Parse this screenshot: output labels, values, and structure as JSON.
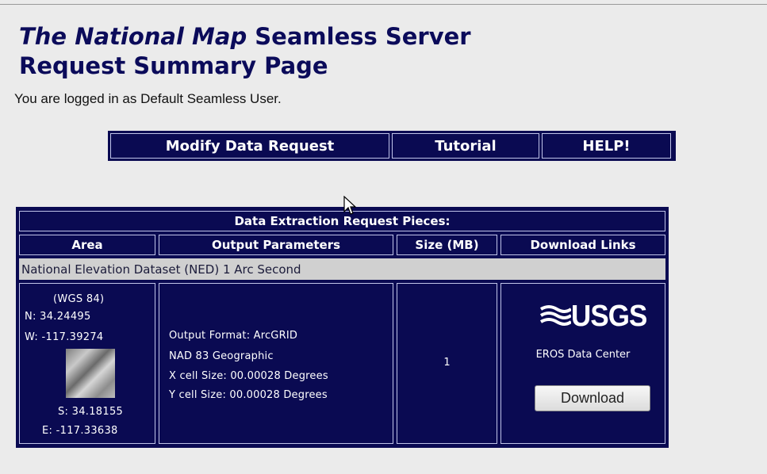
{
  "page": {
    "title_italic": "The National Map",
    "title_rest": " Seamless Server",
    "title_line2": "Request Summary Page",
    "logged_in": "You are logged in as Default Seamless User."
  },
  "nav": {
    "modify": "Modify Data Request",
    "tutorial": "Tutorial",
    "help": "HELP!"
  },
  "table": {
    "heading": "Data Extraction Request Pieces:",
    "columns": [
      "Area",
      "Output Parameters",
      "Size (MB)",
      "Download Links"
    ],
    "dataset": "National Elevation Dataset (NED) 1 Arc Second",
    "area": {
      "datum": "(WGS 84)",
      "north": "N: 34.24495",
      "west": "W: -117.39274",
      "south": "S: 34.18155",
      "east": "E: -117.33638"
    },
    "params": {
      "format": "Output Format: ArcGRID",
      "projection": "NAD 83 Geographic",
      "x_cell": "X cell Size: 00.00028 Degrees",
      "y_cell": "Y cell Size: 00.00028 Degrees"
    },
    "size": "1",
    "download": {
      "logo": "USGS",
      "center": "EROS Data Center",
      "button": "Download"
    }
  },
  "colors": {
    "navy": "#0a0a52",
    "title": "#0b0b5a",
    "dataset_row": "#d0d0d0"
  }
}
